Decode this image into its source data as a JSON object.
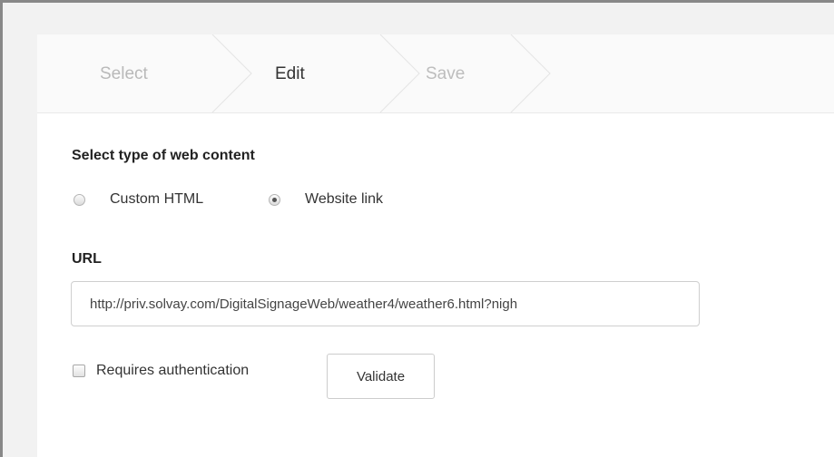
{
  "wizard": {
    "steps": [
      {
        "label": "Select",
        "state": "done"
      },
      {
        "label": "Edit",
        "state": "active"
      },
      {
        "label": "Save",
        "state": "pending"
      }
    ]
  },
  "form": {
    "content_type_label": "Select type of web content",
    "options": [
      {
        "label": "Custom HTML",
        "checked": false
      },
      {
        "label": "Website link",
        "checked": true
      }
    ],
    "url_label": "URL",
    "url_value": "http://priv.solvay.com/DigitalSignageWeb/weather4/weather6.html?nigh",
    "requires_auth_label": "Requires authentication",
    "requires_auth_checked": false,
    "validate_label": "Validate"
  },
  "colors": {
    "frame": "#888888",
    "background": "#f2f2f2",
    "panel": "#ffffff",
    "stepper_background": "#fafafa",
    "active_step_text": "#333333",
    "inactive_step_text": "#b9b9b9"
  }
}
